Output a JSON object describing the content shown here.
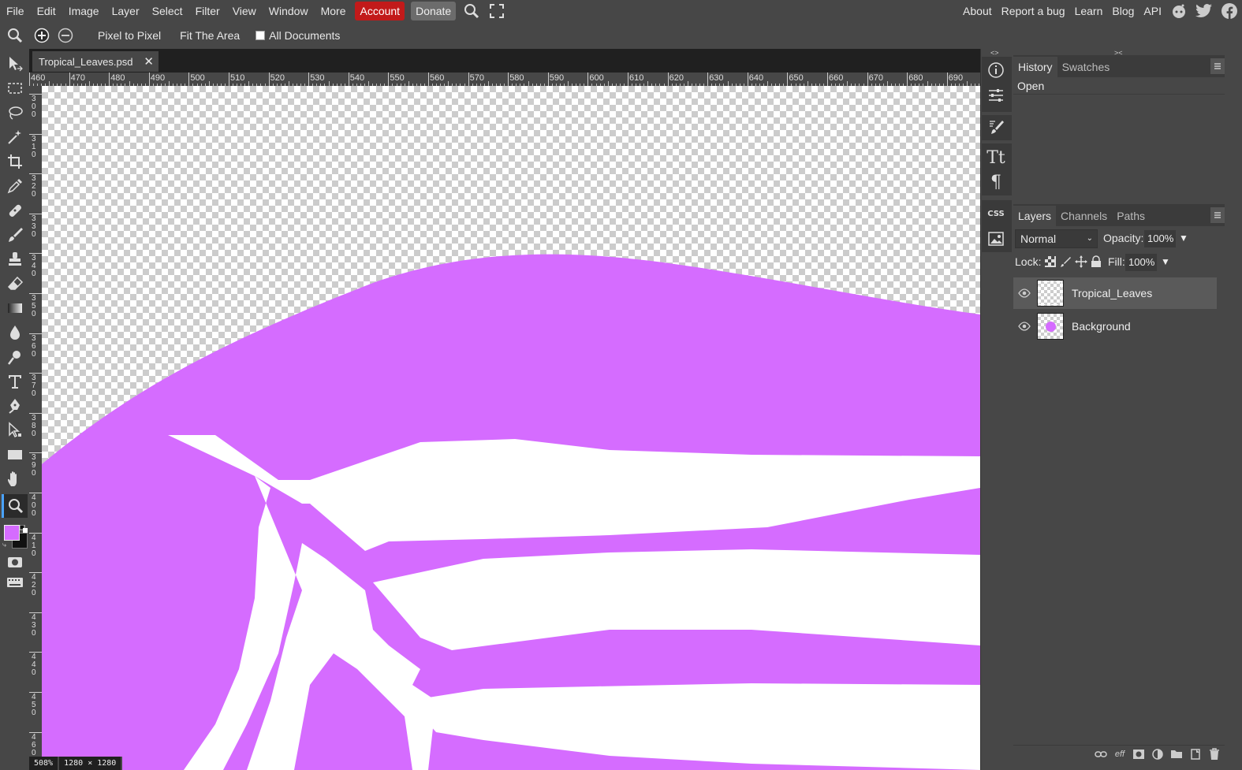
{
  "menu": {
    "items": [
      "File",
      "Edit",
      "Image",
      "Layer",
      "Select",
      "Filter",
      "View",
      "Window",
      "More"
    ],
    "account": "Account",
    "donate": "Donate",
    "right_links": [
      "About",
      "Report a bug",
      "Learn",
      "Blog",
      "API"
    ]
  },
  "options": {
    "pixel_to_pixel": "Pixel to Pixel",
    "fit_area": "Fit The Area",
    "all_documents": "All Documents"
  },
  "document": {
    "tab_title": "Tropical_Leaves.psd",
    "zoom": "508%",
    "size": "1280 × 1280",
    "ruler_labels": [
      "460",
      "470",
      "480",
      "490",
      "500",
      "510",
      "520",
      "530",
      "540",
      "550",
      "560",
      "570",
      "580",
      "590",
      "600",
      "610",
      "620",
      "630",
      "640",
      "650",
      "660",
      "670",
      "680",
      "690"
    ],
    "vruler_labels": [
      "300",
      "310",
      "320",
      "330",
      "340",
      "350",
      "360",
      "370",
      "380",
      "390",
      "400",
      "410",
      "420",
      "430",
      "440",
      "450",
      "460"
    ]
  },
  "panels": {
    "top_tabs": [
      "History",
      "Swatches"
    ],
    "history_items": [
      "Open"
    ],
    "layer_tabs": [
      "Layers",
      "Channels",
      "Paths"
    ],
    "blend_mode": "Normal",
    "opacity_label": "Opacity:",
    "opacity_value": "100%",
    "lock_label": "Lock:",
    "fill_label": "Fill:",
    "fill_value": "100%",
    "layers": [
      {
        "name": "Tropical_Leaves",
        "selected": true
      },
      {
        "name": "Background",
        "selected": false
      }
    ],
    "bottom_fx": "eff"
  },
  "colors": {
    "foreground": "#d56cff",
    "background": "#111111",
    "accent": "#4aa3ff",
    "account_red": "#c21a1a"
  }
}
